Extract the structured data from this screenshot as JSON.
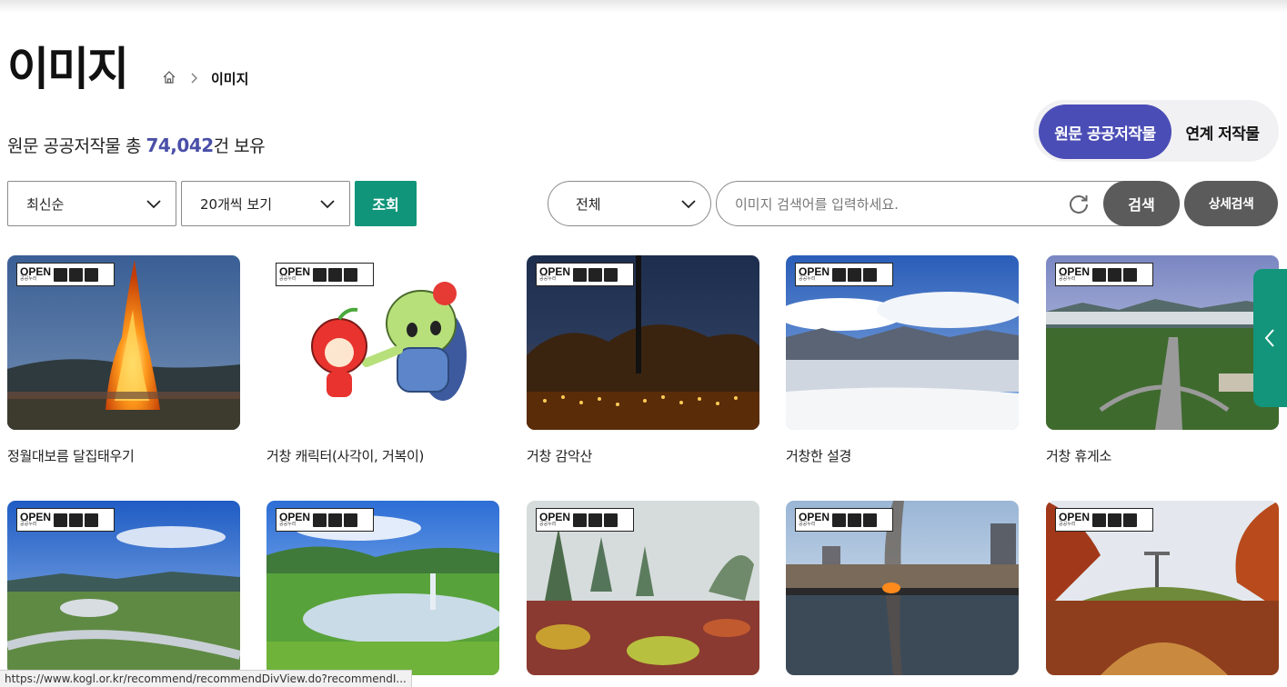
{
  "header": {
    "title": "이미지",
    "breadcrumb": {
      "home_icon": "home-icon",
      "current": "이미지"
    }
  },
  "summary": {
    "prefix": "원문 공공저작물 총 ",
    "count": "74,042",
    "suffix": "건 보유"
  },
  "source_toggle": {
    "active": "원문 공공저작물",
    "inactive": "연계 저작물"
  },
  "filters": {
    "sort": {
      "selected": "최신순"
    },
    "per_page": {
      "selected": "20개씩 보기"
    },
    "view_button": "조회"
  },
  "search": {
    "scope": {
      "selected": "전체"
    },
    "placeholder": "이미지 검색어를 입력하세요.",
    "value": "",
    "reset_icon": "refresh-icon",
    "search_button": "검색",
    "detail_button": "상세검색"
  },
  "ogl_badge": {
    "label": "OPEN",
    "sublabel": "공공누리"
  },
  "gallery": [
    {
      "title": "정월대보름 달집태우기"
    },
    {
      "title": "거창 캐릭터(사각이, 거복이)"
    },
    {
      "title": "거창 감악산"
    },
    {
      "title": "거창한 설경"
    },
    {
      "title": "거창 휴게소"
    },
    {
      "title": ""
    },
    {
      "title": ""
    },
    {
      "title": ""
    },
    {
      "title": ""
    },
    {
      "title": ""
    }
  ],
  "side_panel": {
    "icon": "chevron-left-icon"
  },
  "status_bar": {
    "url": "https://www.kogl.or.kr/recommend/recommendDivView.do?recommendI..."
  },
  "colors": {
    "primary": "#4b4db6",
    "accent": "#11957a",
    "dark_button": "#5b5b5b",
    "count": "#4a4fa8"
  }
}
